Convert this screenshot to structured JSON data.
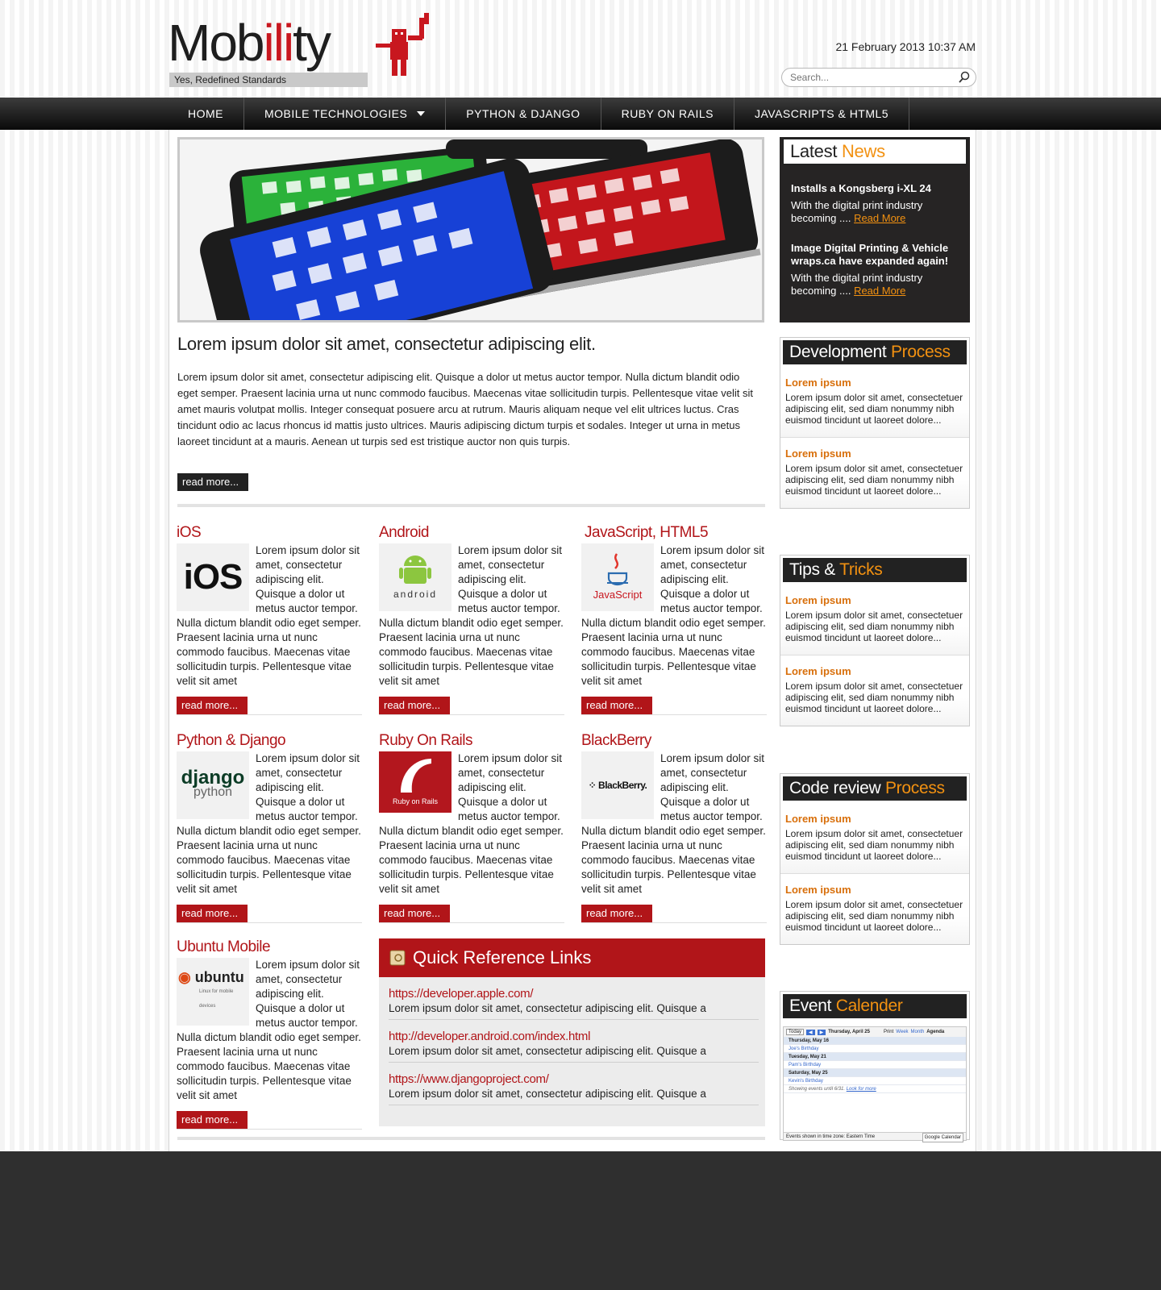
{
  "header": {
    "logo_text_pre": "Mob",
    "logo_text_mid": "ili",
    "logo_text_post": "ty",
    "tagline": "Yes, Redefined Standards",
    "date": "21 February 2013  10:37 AM",
    "search_placeholder": "Search..."
  },
  "nav": {
    "items": [
      {
        "label": "HOME"
      },
      {
        "label": "MOBILE TECHNOLOGIES"
      },
      {
        "label": "PYTHON & DJANGO"
      },
      {
        "label": "RUBY ON RAILS"
      },
      {
        "label": "JAVASCRIPTS & HTML5"
      }
    ]
  },
  "main": {
    "title": "Lorem ipsum dolor sit amet, consectetur adipiscing elit.",
    "text": "Lorem ipsum dolor sit amet, consectetur adipiscing elit. Quisque a dolor ut metus auctor tempor. Nulla dictum blandit odio eget semper. Praesent lacinia urna ut nunc commodo faucibus. Maecenas vitae sollicitudin turpis. Pellentesque vitae velit sit amet mauris volutpat mollis. Integer consequat posuere arcu at rutrum. Mauris aliquam neque vel elit ultrices luctus. Cras tincidunt odio ac lacus rhoncus id mattis justo ultrices. Mauris adipiscing dictum turpis et sodales. Integer ut urna in metus laoreet tincidunt at a mauris. Aenean ut turpis sed est tristique auctor non quis turpis.",
    "read_more": "read more..."
  },
  "cards": [
    {
      "title": "iOS",
      "logo": "iOS",
      "text": "Lorem ipsum dolor sit amet, consectetur adipiscing elit. Quisque a dolor ut metus auctor tempor. Nulla dictum blandit odio eget semper. Praesent lacinia urna ut nunc commodo faucibus. Maecenas vitae sollicitudin turpis. Pellentesque vitae velit sit amet",
      "read_more": "read more..."
    },
    {
      "title": "Android",
      "logo": "android",
      "text": "Lorem ipsum dolor sit amet, consectetur adipiscing elit. Quisque a dolor ut metus auctor tempor. Nulla dictum blandit odio eget semper. Praesent lacinia urna ut nunc commodo faucibus. Maecenas vitae sollicitudin turpis. Pellentesque vitae velit sit amet",
      "read_more": "read more..."
    },
    {
      "title": "JavaScript, HTML5",
      "logo": "JavaScript",
      "text": "Lorem ipsum dolor sit amet, consectetur adipiscing elit. Quisque a dolor ut metus auctor tempor. Nulla dictum blandit odio eget semper. Praesent lacinia urna ut nunc commodo faucibus. Maecenas vitae sollicitudin turpis. Pellentesque vitae velit sit amet",
      "read_more": "read more..."
    },
    {
      "title": "Python & Django",
      "logo": "django",
      "logo2": "python",
      "text": "Lorem ipsum dolor sit amet, consectetur adipiscing elit. Quisque a dolor ut metus auctor tempor. Nulla dictum blandit odio eget semper. Praesent lacinia urna ut nunc commodo faucibus. Maecenas vitae sollicitudin turpis. Pellentesque vitae velit sit amet",
      "read_more": "read more..."
    },
    {
      "title": "Ruby On Rails",
      "logo": "Ruby on Rails",
      "text": "Lorem ipsum dolor sit amet, consectetur adipiscing elit. Quisque a dolor ut metus auctor tempor. Nulla dictum blandit odio eget semper. Praesent lacinia urna ut nunc commodo faucibus. Maecenas vitae sollicitudin turpis. Pellentesque vitae velit sit amet",
      "read_more": "read more..."
    },
    {
      "title": "BlackBerry",
      "logo": "BlackBerry.",
      "text": "Lorem ipsum dolor sit amet, consectetur adipiscing elit. Quisque a dolor ut metus auctor tempor. Nulla dictum blandit odio eget semper. Praesent lacinia urna ut nunc commodo faucibus. Maecenas vitae sollicitudin turpis. Pellentesque vitae velit sit amet",
      "read_more": "read more..."
    },
    {
      "title": "Ubuntu Mobile",
      "logo": "ubuntu",
      "logo2": "Linux for mobile devices",
      "text": "Lorem ipsum dolor sit amet, consectetur adipiscing elit. Quisque a dolor ut metus auctor tempor. Nulla dictum blandit odio eget semper. Praesent lacinia urna ut nunc commodo faucibus. Maecenas vitae sollicitudin turpis. Pellentesque vitae velit sit amet",
      "read_more": "read more..."
    }
  ],
  "quick_ref": {
    "title": "Quick Reference Links",
    "items": [
      {
        "link": "https://developer.apple.com/",
        "desc": "Lorem ipsum dolor sit amet, consectetur adipiscing elit. Quisque a"
      },
      {
        "link": "http://developer.android.com/index.html",
        "desc": "Lorem ipsum dolor sit amet, consectetur adipiscing elit. Quisque a"
      },
      {
        "link": "https://www.djangoproject.com/",
        "desc": "Lorem ipsum dolor sit amet, consectetur adipiscing elit. Quisque a"
      }
    ]
  },
  "news": {
    "title_a": "Latest ",
    "title_b": "News",
    "items": [
      {
        "title": "Installs a Kongsberg i-XL 24",
        "desc": "With the digital print industry becoming ....",
        "link": "Read More"
      },
      {
        "title": "Image Digital Printing & Vehicle wraps.ca have expanded again!",
        "desc": "With the digital print industry becoming ....",
        "link": "Read More"
      }
    ]
  },
  "sidebar": [
    {
      "title_a": "Development ",
      "title_b": "Process",
      "items": [
        {
          "title": "Lorem ipsum",
          "desc": "Lorem ipsum dolor sit amet, consectetuer    adipiscing elit, sed diam nonummy nibh euismod tincidunt ut laoreet dolore..."
        },
        {
          "title": "Lorem ipsum",
          "desc": "Lorem ipsum dolor sit amet, consectetuer    adipiscing elit, sed diam nonummy nibh euismod tincidunt ut laoreet dolore..."
        }
      ]
    },
    {
      "title_a": "Tips & ",
      "title_b": "Tricks",
      "items": [
        {
          "title": "Lorem ipsum",
          "desc": "Lorem ipsum dolor sit amet, consectetuer    adipiscing elit, sed diam nonummy nibh euismod tincidunt ut laoreet dolore..."
        },
        {
          "title": "Lorem ipsum",
          "desc": "Lorem ipsum dolor sit amet, consectetuer    adipiscing elit, sed diam nonummy nibh euismod tincidunt ut laoreet dolore..."
        }
      ]
    },
    {
      "title_a": "Code review ",
      "title_b": "Process",
      "items": [
        {
          "title": "Lorem ipsum",
          "desc": "Lorem ipsum dolor sit amet, consectetuer    adipiscing elit, sed diam nonummy nibh euismod tincidunt ut laoreet dolore..."
        },
        {
          "title": "Lorem ipsum",
          "desc": "Lorem ipsum dolor sit amet, consectetuer    adipiscing elit, sed diam nonummy nibh euismod tincidunt ut laoreet dolore..."
        }
      ]
    }
  ],
  "event": {
    "title_a": "Event ",
    "title_b": "Calender",
    "toolbar": {
      "today": "Today",
      "range": "Thursday, April 25",
      "print": "Print",
      "week": "Week",
      "month": "Month",
      "agenda": "Agenda"
    },
    "rows": [
      {
        "kind": "day",
        "text": "Thursday, May 16"
      },
      {
        "kind": "ev",
        "text": "Joe's Birthday"
      },
      {
        "kind": "day",
        "text": "Tuesday, May 21"
      },
      {
        "kind": "ev",
        "text": "Pam's Birthday"
      },
      {
        "kind": "day",
        "text": "Saturday, May 25"
      },
      {
        "kind": "ev",
        "text": "Kevin's Birthday"
      }
    ],
    "showing": "Showing events until 6/31.",
    "look": "Look for more",
    "footer": "Events shown in time zone: Eastern Time",
    "badge": "Google Calendar"
  },
  "colors": {
    "accent_red": "#b11519",
    "accent_orange": "#f29111",
    "dark": "#222222"
  }
}
